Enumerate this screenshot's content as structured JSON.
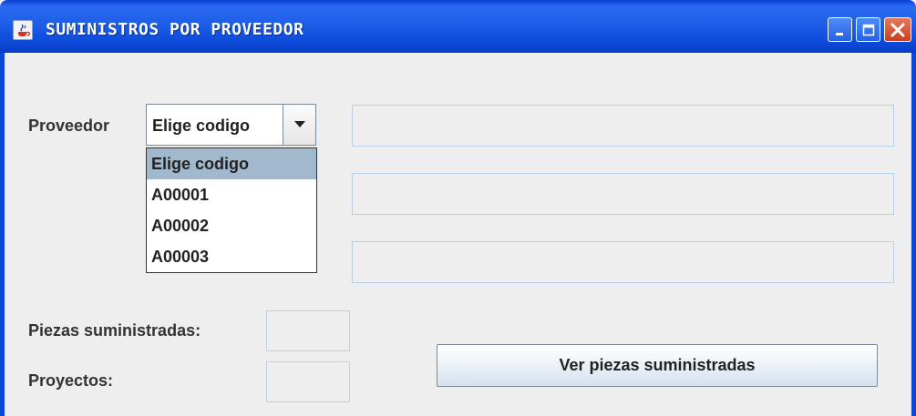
{
  "window": {
    "title": "SUMINISTROS POR PROVEEDOR"
  },
  "form": {
    "proveedor_label": "Proveedor",
    "combo": {
      "selected": "Elige codigo",
      "options": [
        "Elige codigo",
        "A00001",
        "A00002",
        "A00003"
      ],
      "highlighted_index": 0
    },
    "piezas_label": "Piezas suministradas:",
    "proyectos_label": "Proyectos:",
    "ver_button_label": "Ver piezas suministradas"
  },
  "icons": {
    "app": "java-coffee-icon",
    "minimize": "minimize-icon",
    "maximize": "maximize-icon",
    "close": "close-icon",
    "dropdown": "triangle-down-icon"
  },
  "colors": {
    "titlebar": "#1f5fe8",
    "close_button": "#c6401c",
    "dropdown_selection": "#a2b8cd",
    "textbox_border": "#b8cfe5"
  }
}
